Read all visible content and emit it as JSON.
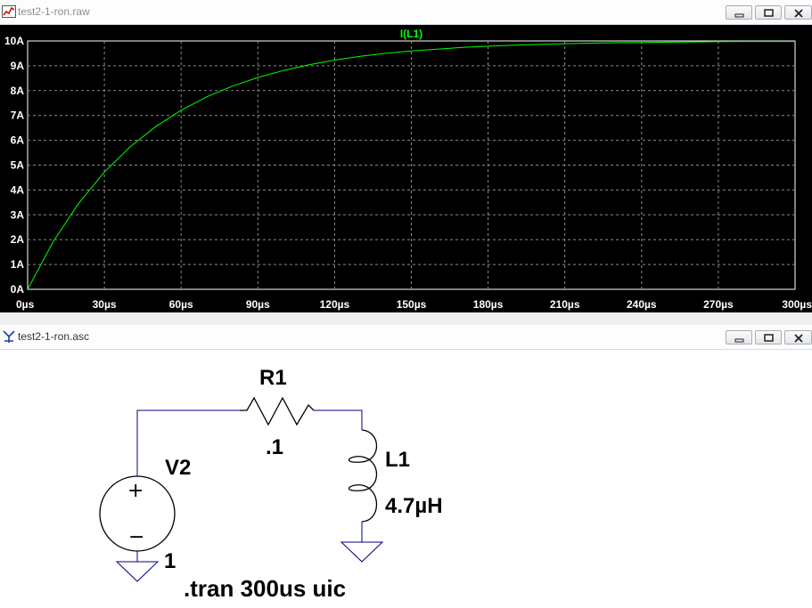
{
  "plot_window": {
    "title": "test2-1-ron.raw",
    "icon": "waveform-icon"
  },
  "schematic_window": {
    "title": "test2-1-ron.asc",
    "icon": "schematic-icon"
  },
  "chart_data": {
    "type": "line",
    "trace_label": "I(L1)",
    "trace_color": "#00ff00",
    "background": "#000000",
    "grid": true,
    "x_ticks": [
      "0µs",
      "30µs",
      "60µs",
      "90µs",
      "120µs",
      "150µs",
      "180µs",
      "210µs",
      "240µs",
      "270µs",
      "300µs"
    ],
    "y_ticks": [
      "0A",
      "1A",
      "2A",
      "3A",
      "4A",
      "5A",
      "6A",
      "7A",
      "8A",
      "9A",
      "10A"
    ],
    "xlim_us": [
      0,
      300
    ],
    "ylim_A": [
      0,
      10
    ],
    "series": [
      {
        "name": "I(L1)",
        "x_us": [
          0,
          10,
          20,
          30,
          40,
          50,
          60,
          70,
          80,
          90,
          100,
          110,
          120,
          130,
          140,
          150,
          160,
          170,
          180,
          190,
          200,
          210,
          220,
          230,
          240,
          250,
          260,
          270,
          280,
          290,
          300
        ],
        "y_A": [
          0,
          1.92,
          3.47,
          4.72,
          5.73,
          6.55,
          7.21,
          7.75,
          8.18,
          8.53,
          8.81,
          9.04,
          9.23,
          9.38,
          9.5,
          9.6,
          9.67,
          9.74,
          9.79,
          9.83,
          9.86,
          9.89,
          9.91,
          9.93,
          9.94,
          9.95,
          9.96,
          9.97,
          9.98,
          9.98,
          9.98
        ]
      }
    ]
  },
  "schematic": {
    "resistor": {
      "name": "R1",
      "value": ".1"
    },
    "inductor": {
      "name": "L1",
      "value": "4.7µH"
    },
    "source": {
      "name": "V2",
      "value": "1",
      "plus": "+",
      "minus": "−"
    },
    "directive": ".tran 300us uic",
    "wire_color": "#000080",
    "component_color": "#000000"
  }
}
